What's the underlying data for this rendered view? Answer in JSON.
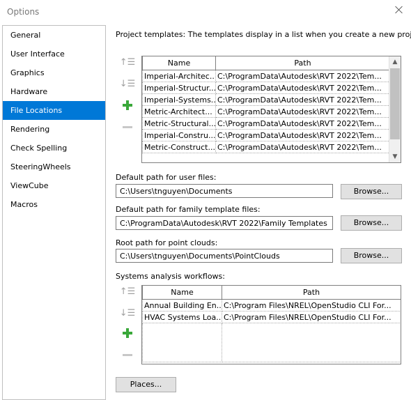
{
  "window": {
    "title": "Options"
  },
  "sidebar": {
    "items": [
      {
        "label": "General"
      },
      {
        "label": "User Interface"
      },
      {
        "label": "Graphics"
      },
      {
        "label": "Hardware"
      },
      {
        "label": "File Locations",
        "selected": true
      },
      {
        "label": "Rendering"
      },
      {
        "label": "Check Spelling"
      },
      {
        "label": "SteeringWheels"
      },
      {
        "label": "ViewCube"
      },
      {
        "label": "Macros"
      }
    ]
  },
  "project_templates": {
    "label": "Project templates:  The templates display in a list when you create a new project.",
    "columns": {
      "name": "Name",
      "path": "Path"
    },
    "rows": [
      {
        "name": "Imperial-Architec...",
        "path": "C:\\ProgramData\\Autodesk\\RVT 2022\\Tem..."
      },
      {
        "name": "Imperial-Structur...",
        "path": "C:\\ProgramData\\Autodesk\\RVT 2022\\Tem..."
      },
      {
        "name": "Imperial-Systems...",
        "path": "C:\\ProgramData\\Autodesk\\RVT 2022\\Tem..."
      },
      {
        "name": "Metric-Architect...",
        "path": "C:\\ProgramData\\Autodesk\\RVT 2022\\Tem..."
      },
      {
        "name": "Metric-Structural...",
        "path": "C:\\ProgramData\\Autodesk\\RVT 2022\\Tem..."
      },
      {
        "name": "Imperial-Constru...",
        "path": "C:\\ProgramData\\Autodesk\\RVT 2022\\Tem..."
      },
      {
        "name": "Metric-Construct...",
        "path": "C:\\ProgramData\\Autodesk\\RVT 2022\\Tem..."
      }
    ]
  },
  "user_files": {
    "label": "Default path for user files:",
    "value": "C:\\Users\\tnguyen\\Documents",
    "browse": "Browse..."
  },
  "family_templates": {
    "label": "Default path for family template files:",
    "value": "C:\\ProgramData\\Autodesk\\RVT 2022\\Family Templates",
    "browse": "Browse..."
  },
  "point_clouds": {
    "label": "Root path for point clouds:",
    "value": "C:\\Users\\tnguyen\\Documents\\PointClouds",
    "browse": "Browse..."
  },
  "analysis_workflows": {
    "label": "Systems analysis workflows:",
    "columns": {
      "name": "Name",
      "path": "Path"
    },
    "rows": [
      {
        "name": "Annual Building En...",
        "path": "C:\\Program Files\\NREL\\OpenStudio CLI For..."
      },
      {
        "name": "HVAC Systems Loa...",
        "path": "C:\\Program Files\\NREL\\OpenStudio CLI For..."
      }
    ]
  },
  "places_button": "Places...",
  "icons": {
    "move_up": "move-up-icon",
    "move_down": "move-down-icon",
    "add": "add-icon",
    "remove": "remove-icon",
    "close": "close-icon"
  },
  "colors": {
    "selection": "#0078d7",
    "add_green": "#3aa83a"
  }
}
